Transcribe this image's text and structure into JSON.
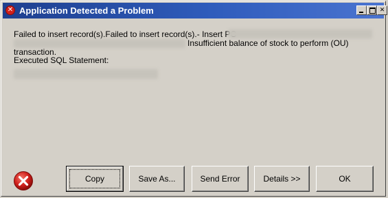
{
  "window": {
    "title": "Application Detected a Problem",
    "title_icon": "error-badge-icon",
    "caption_buttons": [
      "minimize-icon",
      "maximize-icon",
      "close-icon"
    ]
  },
  "message": {
    "line1": "Failed to insert record(s).Failed to insert record(s).- Insert PO",
    "line2": "Insufficient balance of stock to perform (OU)",
    "line3": "transaction.",
    "line4": "Executed SQL Statement:"
  },
  "buttons": {
    "copy": "Copy",
    "save_as": "Save As...",
    "send_error": "Send Error",
    "details": "Details >>",
    "ok": "OK"
  },
  "icons": {
    "large": "error-icon"
  },
  "colors": {
    "titlebar_start": "#1e3f8f",
    "titlebar_end": "#4a74d0",
    "dialog_bg": "#d4d0c8",
    "error_red": "#d0201c"
  }
}
